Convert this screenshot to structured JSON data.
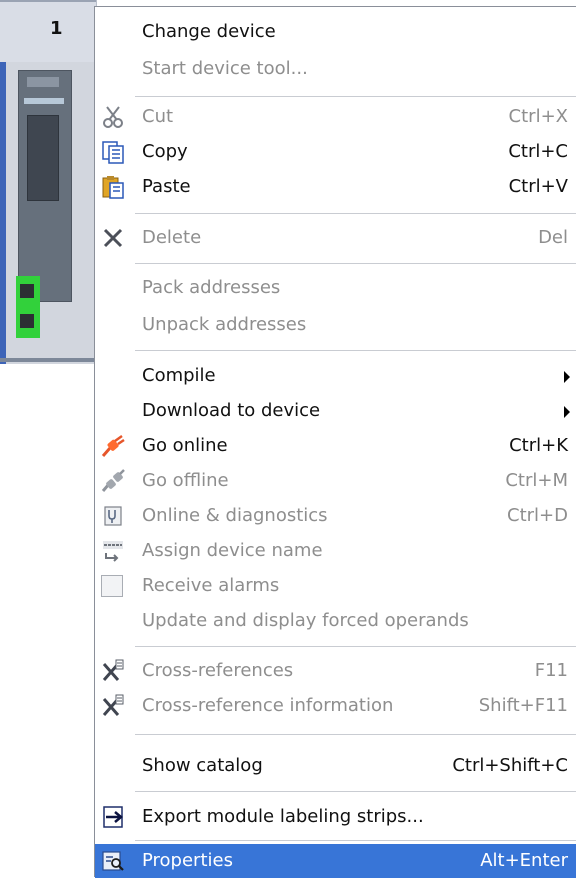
{
  "background": {
    "slot_number": "1"
  },
  "menu": {
    "items": [
      {
        "label": "Change device",
        "shortcut": "",
        "icon": "",
        "enabled": true
      },
      {
        "label": "Start device tool...",
        "shortcut": "",
        "icon": "",
        "enabled": false
      },
      {
        "label": "Cut",
        "shortcut": "Ctrl+X",
        "icon": "scissors-icon",
        "enabled": false
      },
      {
        "label": "Copy",
        "shortcut": "Ctrl+C",
        "icon": "copy-icon",
        "enabled": true
      },
      {
        "label": "Paste",
        "shortcut": "Ctrl+V",
        "icon": "paste-icon",
        "enabled": true
      },
      {
        "label": "Delete",
        "shortcut": "Del",
        "icon": "delete-icon",
        "enabled": false
      },
      {
        "label": "Pack addresses",
        "shortcut": "",
        "icon": "",
        "enabled": false
      },
      {
        "label": "Unpack addresses",
        "shortcut": "",
        "icon": "",
        "enabled": false
      },
      {
        "label": "Compile",
        "shortcut": "",
        "icon": "",
        "enabled": true,
        "submenu": true
      },
      {
        "label": "Download to device",
        "shortcut": "",
        "icon": "",
        "enabled": true,
        "submenu": true
      },
      {
        "label": "Go online",
        "shortcut": "Ctrl+K",
        "icon": "go-online-icon",
        "enabled": true
      },
      {
        "label": "Go offline",
        "shortcut": "Ctrl+M",
        "icon": "go-offline-icon",
        "enabled": false
      },
      {
        "label": "Online & diagnostics",
        "shortcut": "Ctrl+D",
        "icon": "diagnostics-icon",
        "enabled": false
      },
      {
        "label": "Assign device name",
        "shortcut": "",
        "icon": "assign-name-icon",
        "enabled": false
      },
      {
        "label": "Receive alarms",
        "shortcut": "",
        "icon": "checkbox-icon",
        "enabled": false
      },
      {
        "label": "Update and display forced operands",
        "shortcut": "",
        "icon": "",
        "enabled": false
      },
      {
        "label": "Cross-references",
        "shortcut": "F11",
        "icon": "cross-reference-icon",
        "enabled": false
      },
      {
        "label": "Cross-reference information",
        "shortcut": "Shift+F11",
        "icon": "cross-reference-info-icon",
        "enabled": false
      },
      {
        "label": "Show catalog",
        "shortcut": "Ctrl+Shift+C",
        "icon": "",
        "enabled": true
      },
      {
        "label": "Export module labeling strips...",
        "shortcut": "",
        "icon": "export-icon",
        "enabled": true
      },
      {
        "label": "Properties",
        "shortcut": "Alt+Enter",
        "icon": "properties-icon",
        "enabled": true,
        "selected": true
      }
    ]
  },
  "colors": {
    "selection": "#3875d7",
    "disabled_text": "#8e8e8e",
    "module_port_green": "#32d13b"
  }
}
